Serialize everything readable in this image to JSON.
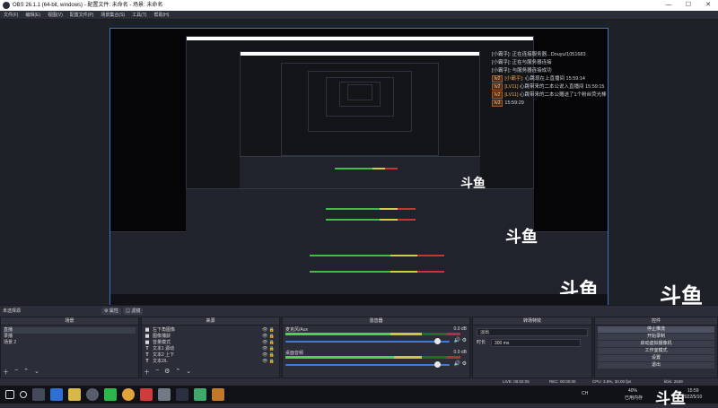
{
  "window": {
    "title": "OBS 26.1.1 (64-bit, windows) - 配置文件: 未命名 - 场景: 未命名",
    "min": "—",
    "max": "☐",
    "close": "✕"
  },
  "menu": [
    "文件(F)",
    "编辑(E)",
    "视图(V)",
    "配置文件(P)",
    "场景集合(S)",
    "工具(T)",
    "帮助(H)"
  ],
  "chat": {
    "lines": [
      {
        "prefix": "[小霸乎]:",
        "text": "正在连接服务器...Douyu/1051683"
      },
      {
        "prefix": "[小霸乎]:",
        "text": "正在与服务器连接"
      },
      {
        "prefix": "[小霸乎]:",
        "text": "与服务器连接成功"
      },
      {
        "tag": "lv2",
        "name": "[小霸乎]:",
        "text": "心跳现在上直播间 15:59:14"
      },
      {
        "tag": "lv2",
        "name": "[LV11]",
        "text": "心跳带来的二本公说入直播间 15:59:15"
      },
      {
        "tag": "lv2",
        "name": "[LV11]",
        "text": "心跳带来的二本公赠送了1个粉丝荧光棒"
      },
      {
        "tag": "lv3",
        "name": "",
        "text": "15:59:29"
      }
    ]
  },
  "scene_strip": {
    "label": "未选择源",
    "properties_btn": "⚙ 属性",
    "filters_btn": "▤ 滤镜"
  },
  "scenes": {
    "header": "场景",
    "items": [
      "直播",
      "录播",
      "场景 2"
    ],
    "selected_index": 0
  },
  "sources": {
    "header": "来源",
    "items": [
      {
        "icon": "▦",
        "label": "左下角图像"
      },
      {
        "icon": "▦",
        "label": "图像捕获"
      },
      {
        "icon": "▦",
        "label": "音量模式"
      },
      {
        "icon": "T",
        "label": "文本1 源动"
      },
      {
        "icon": "T",
        "label": "文本2 上下"
      },
      {
        "icon": "T",
        "label": "文本2/L"
      }
    ]
  },
  "mixer": {
    "header": "混音器",
    "channels": [
      {
        "label": "麦克风/Aux",
        "db": "0.0 dB",
        "level": 0.68,
        "volume": 0.92
      },
      {
        "label": "桌面音频",
        "db": "0.0 dB",
        "level": 0.7,
        "volume": 0.92
      }
    ]
  },
  "transitions": {
    "header": "转场特效",
    "type": "淡出",
    "duration_label": "时长",
    "duration": "300 ms"
  },
  "controls": {
    "header": "控件",
    "buttons": [
      "停止推流",
      "开始录制",
      "启动虚拟摄像机",
      "工作室模式",
      "设置",
      "退出"
    ]
  },
  "status": {
    "fps": "LIVE: 00:02:05",
    "rec": "REC: 00:00:00",
    "cpu": "CPU: 3.8%, 30.00 fps",
    "kbps": "kb/s: 2539"
  },
  "taskbar": {
    "cpu_temp": "40%",
    "cpu_label": "已用内存",
    "time": "15:59",
    "date": "2022/5/10",
    "lang": "中",
    "ch": "CH"
  },
  "logo_text": "斗鱼",
  "colors": {
    "accent": "#3b73c8",
    "panel": "#2b2e38",
    "meter_green": "#4fd24f",
    "meter_yellow": "#c9c93a",
    "meter_red": "#b03232"
  }
}
